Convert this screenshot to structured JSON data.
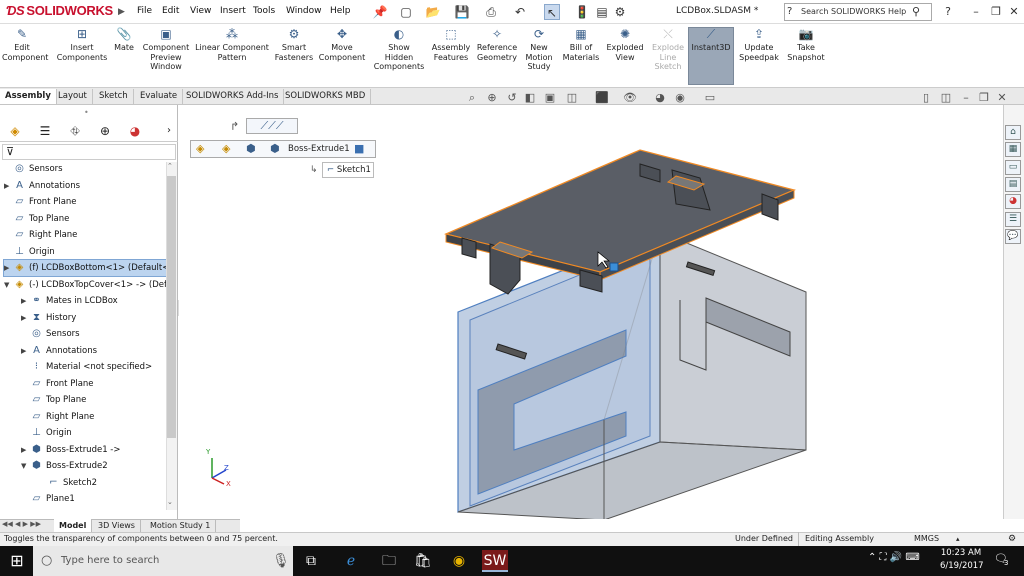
{
  "app": {
    "logo": "SOLIDWORKS",
    "doc_title": "LCDBox.SLDASM *",
    "help_placeholder": "Search SOLIDWORKS Help"
  },
  "menu": [
    "File",
    "Edit",
    "View",
    "Insert",
    "Tools",
    "Window",
    "Help"
  ],
  "ribbon": [
    {
      "id": "edit-component",
      "label": "Edit\nComponent",
      "icon": "edit-component-icon"
    },
    {
      "id": "insert-components",
      "label": "Insert\nComponents",
      "icon": "insert-components-icon"
    },
    {
      "id": "mate",
      "label": "Mate",
      "icon": "mate-icon"
    },
    {
      "id": "component-preview",
      "label": "Component\nPreview\nWindow",
      "icon": "preview-window-icon"
    },
    {
      "id": "linear-pattern",
      "label": "Linear Component\nPattern",
      "icon": "linear-pattern-icon"
    },
    {
      "id": "smart-fasteners",
      "label": "Smart\nFasteners",
      "icon": "smart-fasteners-icon"
    },
    {
      "id": "move-component",
      "label": "Move\nComponent",
      "icon": "move-component-icon"
    },
    {
      "id": "show-hidden",
      "label": "Show\nHidden\nComponents",
      "icon": "show-hidden-icon"
    },
    {
      "id": "assembly-features",
      "label": "Assembly\nFeatures",
      "icon": "assembly-features-icon"
    },
    {
      "id": "reference-geometry",
      "label": "Reference\nGeometry",
      "icon": "reference-geometry-icon"
    },
    {
      "id": "new-motion-study",
      "label": "New\nMotion\nStudy",
      "icon": "motion-study-icon"
    },
    {
      "id": "bill-of-materials",
      "label": "Bill of\nMaterials",
      "icon": "bom-icon"
    },
    {
      "id": "exploded-view",
      "label": "Exploded\nView",
      "icon": "exploded-view-icon"
    },
    {
      "id": "explode-line-sketch",
      "label": "Explode\nLine\nSketch",
      "icon": "explode-line-icon",
      "disabled": true
    },
    {
      "id": "instant3d",
      "label": "Instant3D",
      "icon": "instant3d-icon",
      "active": true
    },
    {
      "id": "update-speedpak",
      "label": "Update\nSpeedpak",
      "icon": "speedpak-icon"
    },
    {
      "id": "take-snapshot",
      "label": "Take\nSnapshot",
      "icon": "camera-icon"
    }
  ],
  "tabs": [
    "Assembly",
    "Layout",
    "Sketch",
    "Evaluate",
    "SOLIDWORKS Add-Ins",
    "SOLIDWORKS MBD"
  ],
  "tree": [
    {
      "label": "Sensors",
      "indent": 0,
      "expand": "",
      "icon": "sensor-icon"
    },
    {
      "label": "Annotations",
      "indent": 0,
      "expand": "▶",
      "icon": "annotations-icon"
    },
    {
      "label": "Front Plane",
      "indent": 0,
      "expand": "",
      "icon": "plane-icon"
    },
    {
      "label": "Top Plane",
      "indent": 0,
      "expand": "",
      "icon": "plane-icon"
    },
    {
      "label": "Right Plane",
      "indent": 0,
      "expand": "",
      "icon": "plane-icon"
    },
    {
      "label": "Origin",
      "indent": 0,
      "expand": "",
      "icon": "origin-icon"
    },
    {
      "label": "(f) LCDBoxBottom<1> (Default<",
      "indent": 0,
      "expand": "▶",
      "icon": "part-icon",
      "selected": true
    },
    {
      "label": "(-) LCDBoxTopCover<1> -> (Def",
      "indent": 0,
      "expand": "▼",
      "icon": "part-icon"
    },
    {
      "label": "Mates in LCDBox",
      "indent": 1,
      "expand": "▶",
      "icon": "mates-icon"
    },
    {
      "label": "History",
      "indent": 1,
      "expand": "▶",
      "icon": "history-icon"
    },
    {
      "label": "Sensors",
      "indent": 1,
      "expand": "",
      "icon": "sensor-icon"
    },
    {
      "label": "Annotations",
      "indent": 1,
      "expand": "▶",
      "icon": "annotations-icon"
    },
    {
      "label": "Material <not specified>",
      "indent": 1,
      "expand": "",
      "icon": "material-icon"
    },
    {
      "label": "Front Plane",
      "indent": 1,
      "expand": "",
      "icon": "plane-icon"
    },
    {
      "label": "Top Plane",
      "indent": 1,
      "expand": "",
      "icon": "plane-icon"
    },
    {
      "label": "Right Plane",
      "indent": 1,
      "expand": "",
      "icon": "plane-icon"
    },
    {
      "label": "Origin",
      "indent": 1,
      "expand": "",
      "icon": "origin-icon"
    },
    {
      "label": "Boss-Extrude1 ->",
      "indent": 1,
      "expand": "▶",
      "icon": "extrude-icon"
    },
    {
      "label": "Boss-Extrude2",
      "indent": 1,
      "expand": "▼",
      "icon": "extrude-icon"
    },
    {
      "label": "Sketch2",
      "indent": 2,
      "expand": "",
      "icon": "sketch-icon"
    },
    {
      "label": "Plane1",
      "indent": 1,
      "expand": "",
      "icon": "plane-icon"
    }
  ],
  "breadcrumb": {
    "feature": "Boss-Extrude1",
    "sketch": "Sketch1"
  },
  "bottom_tabs": [
    "Model",
    "3D Views",
    "Motion Study 1"
  ],
  "status": {
    "message": "Toggles the transparency of components between 0 and 75 percent.",
    "state": "Under Defined",
    "mode": "Editing Assembly",
    "units": "MMGS"
  },
  "taskbar": {
    "search": "Type here to search",
    "time": "10:23 AM",
    "date": "6/19/2017",
    "notifications": "3"
  },
  "colors": {
    "accent": "#c8102e",
    "selection": "#bcd4ef",
    "edge_highlight": "#f08a24"
  }
}
